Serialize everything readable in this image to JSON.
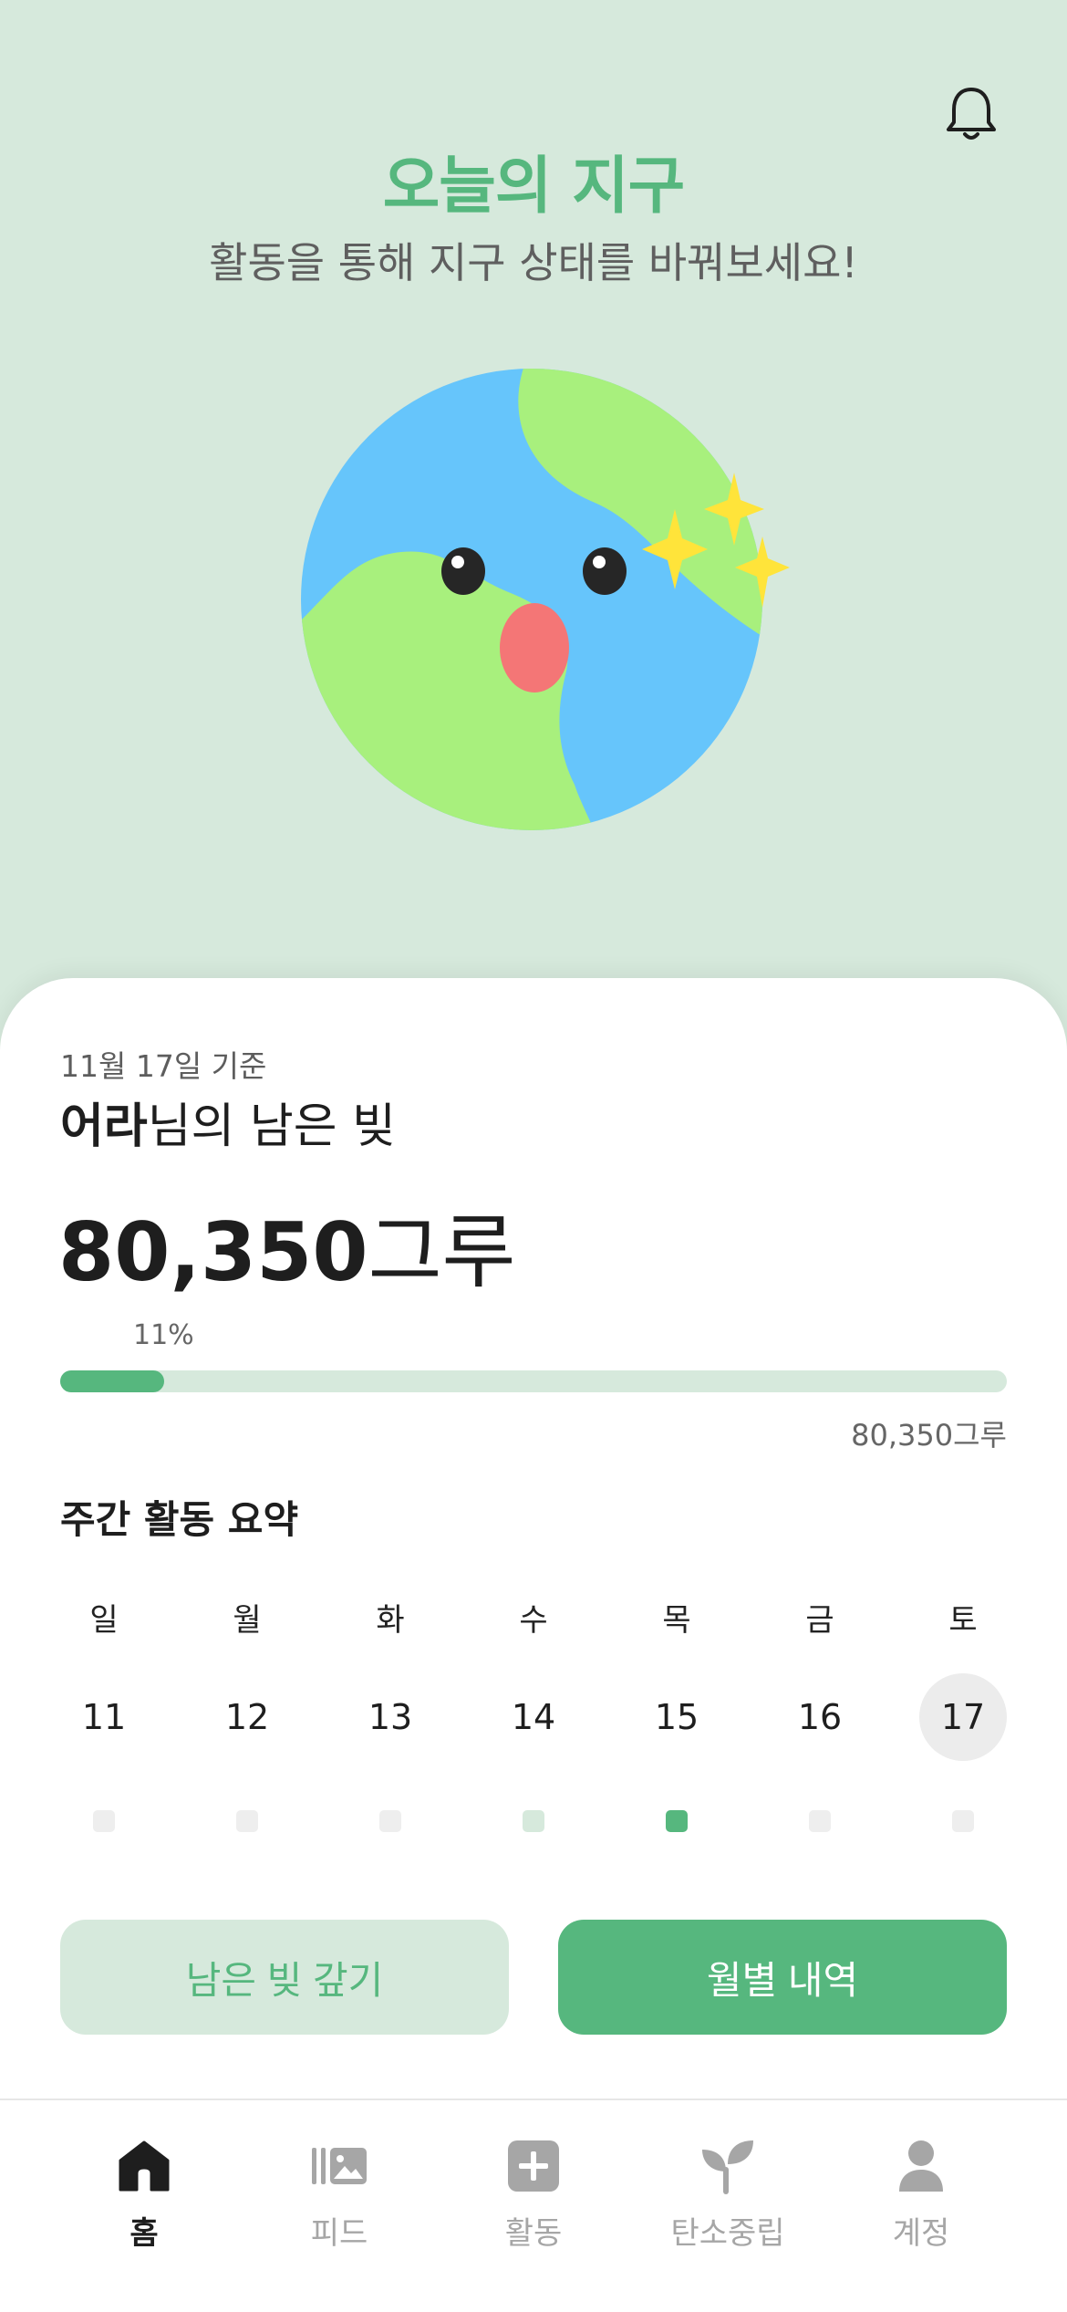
{
  "header": {
    "title": "오늘의 지구",
    "subtitle": "활동을 통해 지구 상태를 바꿔보세요!",
    "bell_icon": "bell-icon"
  },
  "earth": {
    "illustration": "smiling-earth-with-sparkles"
  },
  "summary": {
    "as_of": "11월 17일 기준",
    "user_name": "어라",
    "debt_label_suffix": "님의 남은 빚",
    "amount": "80,350",
    "unit": "그루",
    "progress_percent_label": "11%",
    "progress_fraction": 0.11,
    "total_label": "80,350그루"
  },
  "weekly": {
    "title": "주간 활동 요약",
    "days": [
      {
        "dow": "일",
        "date": "11",
        "today": false,
        "level": 0
      },
      {
        "dow": "월",
        "date": "12",
        "today": false,
        "level": 0
      },
      {
        "dow": "화",
        "date": "13",
        "today": false,
        "level": 0
      },
      {
        "dow": "수",
        "date": "14",
        "today": false,
        "level": 1
      },
      {
        "dow": "목",
        "date": "15",
        "today": false,
        "level": 2
      },
      {
        "dow": "금",
        "date": "16",
        "today": false,
        "level": 0
      },
      {
        "dow": "토",
        "date": "17",
        "today": true,
        "level": 0
      }
    ]
  },
  "buttons": {
    "pay": "남은 빚 갚기",
    "monthly": "월별 내역"
  },
  "tabs": [
    {
      "label": "홈",
      "icon": "home-icon",
      "active": true
    },
    {
      "label": "피드",
      "icon": "feed-icon",
      "active": false
    },
    {
      "label": "활동",
      "icon": "plus-square-icon",
      "active": false
    },
    {
      "label": "탄소중립",
      "icon": "sprout-icon",
      "active": false
    },
    {
      "label": "계정",
      "icon": "person-icon",
      "active": false
    }
  ],
  "colors": {
    "accent": "#56b77e",
    "accent_light": "#d6e9dc",
    "ocean": "#66c5fb",
    "land": "#a8f07d",
    "sparkle": "#ffe43a",
    "nose": "#f47676"
  }
}
